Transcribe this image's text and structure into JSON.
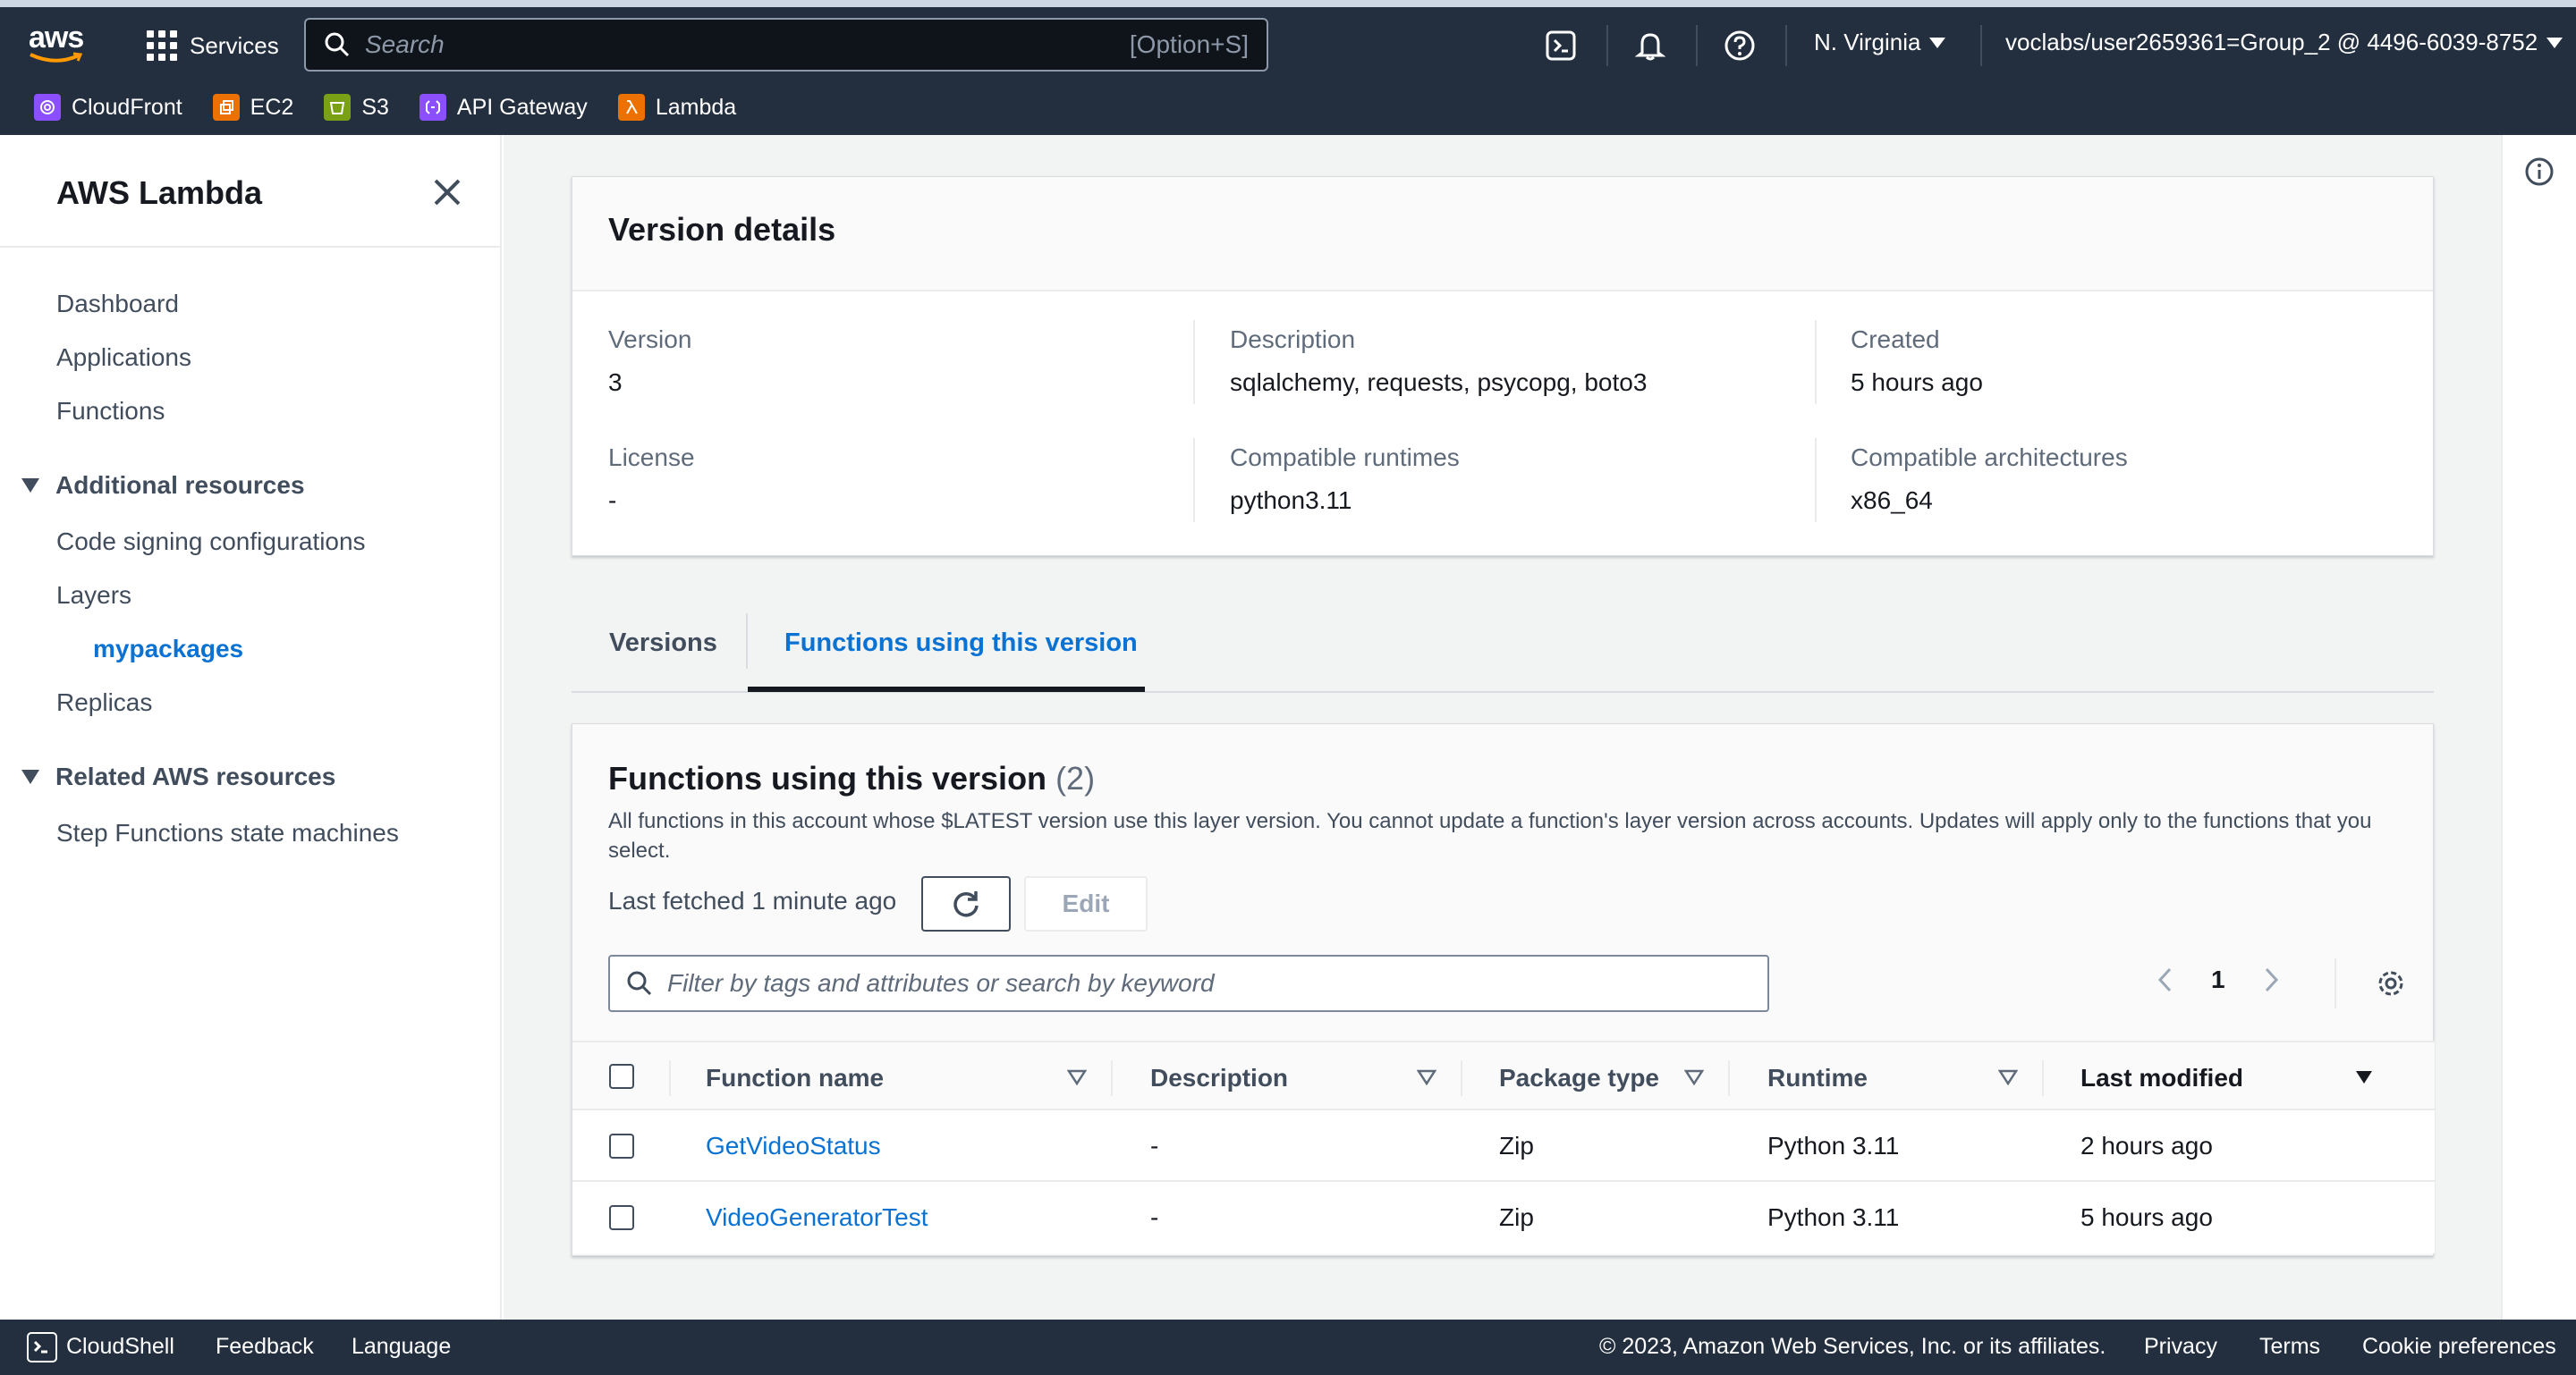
{
  "topnav": {
    "logo": "aws",
    "services_label": "Services",
    "search_placeholder": "Search",
    "search_shortcut": "[Option+S]",
    "region": "N. Virginia",
    "account": "voclabs/user2659361=Group_2 @ 4496-6039-8752",
    "icons": [
      "cloudshell-icon",
      "bell-icon",
      "help-icon"
    ],
    "favorites": [
      {
        "label": "CloudFront",
        "color": "#8c4fff"
      },
      {
        "label": "EC2",
        "color": "#ed7100"
      },
      {
        "label": "S3",
        "color": "#7aa116"
      },
      {
        "label": "API Gateway",
        "color": "#8c4fff"
      },
      {
        "label": "Lambda",
        "color": "#ed7100"
      }
    ]
  },
  "sidebar": {
    "title": "AWS Lambda",
    "links": [
      "Dashboard",
      "Applications",
      "Functions"
    ],
    "additional_resources": {
      "label": "Additional resources",
      "items": [
        "Code signing configurations",
        "Layers",
        "Replicas"
      ],
      "active_sub_item": "mypackages"
    },
    "related_resources": {
      "label": "Related AWS resources",
      "items": [
        "Step Functions state machines"
      ]
    }
  },
  "version_details": {
    "title": "Version details",
    "fields": [
      {
        "label": "Version",
        "value": "3"
      },
      {
        "label": "Description",
        "value": "sqlalchemy, requests, psycopg, boto3"
      },
      {
        "label": "Created",
        "value": "5 hours ago"
      },
      {
        "label": "License",
        "value": "-"
      },
      {
        "label": "Compatible runtimes",
        "value": "python3.11"
      },
      {
        "label": "Compatible architectures",
        "value": "x86_64"
      }
    ]
  },
  "tabs": [
    {
      "label": "Versions",
      "active": false
    },
    {
      "label": "Functions using this version",
      "active": true
    }
  ],
  "functions_panel": {
    "title": "Functions using this version",
    "count": "(2)",
    "description": "All functions in this account whose $LATEST version use this layer version. You cannot update a function's layer version across accounts. Updates will apply only to the functions that you select.",
    "last_fetched": "Last fetched 1 minute ago",
    "edit_label": "Edit",
    "filter_placeholder": "Filter by tags and attributes or search by keyword",
    "current_page": "1",
    "columns": [
      "Function name",
      "Description",
      "Package type",
      "Runtime",
      "Last modified"
    ],
    "rows": [
      {
        "name": "GetVideoStatus",
        "description": "-",
        "package_type": "Zip",
        "runtime": "Python 3.11",
        "last_modified": "2 hours ago"
      },
      {
        "name": "VideoGeneratorTest",
        "description": "-",
        "package_type": "Zip",
        "runtime": "Python 3.11",
        "last_modified": "5 hours ago"
      }
    ]
  },
  "footer": {
    "cloudshell": "CloudShell",
    "feedback": "Feedback",
    "language": "Language",
    "copyright": "© 2023, Amazon Web Services, Inc. or its affiliates.",
    "privacy": "Privacy",
    "terms": "Terms",
    "cookies": "Cookie preferences"
  }
}
